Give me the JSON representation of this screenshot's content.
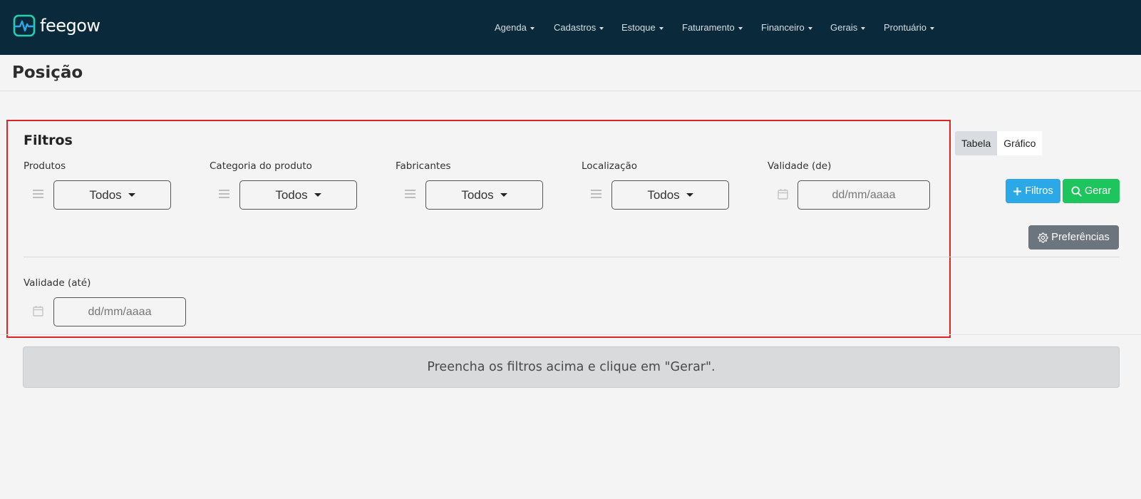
{
  "app": {
    "logo_text": "feegow",
    "logo_color": "#1fd1b0"
  },
  "nav": {
    "items": [
      {
        "label": "Agenda"
      },
      {
        "label": "Cadastros"
      },
      {
        "label": "Estoque"
      },
      {
        "label": "Faturamento"
      },
      {
        "label": "Financeiro"
      },
      {
        "label": "Gerais"
      },
      {
        "label": "Prontuário"
      }
    ]
  },
  "page": {
    "title": "Posição"
  },
  "filters": {
    "heading": "Filtros",
    "produtos": {
      "label": "Produtos",
      "value": "Todos"
    },
    "categoria": {
      "label": "Categoria do produto",
      "value": "Todos"
    },
    "fabricantes": {
      "label": "Fabricantes",
      "value": "Todos"
    },
    "localizacao": {
      "label": "Localização",
      "value": "Todos"
    },
    "validade_de": {
      "label": "Validade (de)",
      "placeholder": "dd/mm/aaaa"
    },
    "validade_ate": {
      "label": "Validade (até)",
      "placeholder": "dd/mm/aaaa"
    }
  },
  "view_toggle": {
    "tabela": "Tabela",
    "grafico": "Gráfico",
    "active": "Tabela"
  },
  "actions": {
    "filtros_label": "Filtros",
    "gerar_label": "Gerar",
    "preferencias_label": "Preferências"
  },
  "message": {
    "text": "Preencha os filtros acima e clique em \"Gerar\"."
  },
  "colors": {
    "navbar": "#0a2a3c",
    "filtros_button": "#2aa8e8",
    "gerar_button": "#1ec45c",
    "preferencias_button": "#6c757d",
    "highlight_border": "#e02424"
  }
}
